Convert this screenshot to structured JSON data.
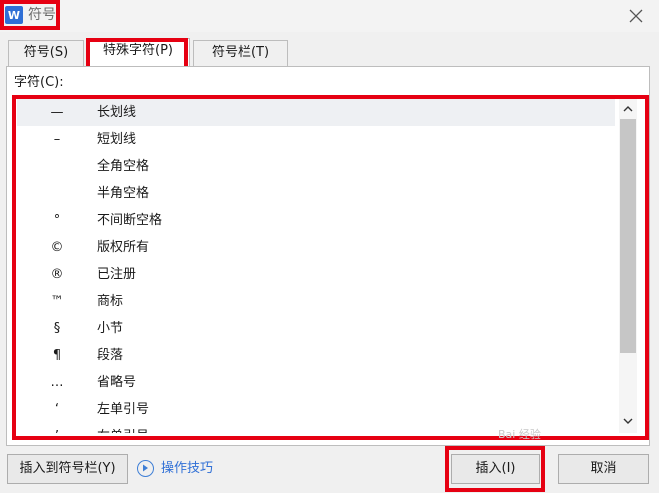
{
  "window": {
    "title": "符号",
    "app_icon_letter": "W"
  },
  "tabs": [
    {
      "label": "符号(S)"
    },
    {
      "label": "特殊字符(P)"
    },
    {
      "label": "符号栏(T)"
    }
  ],
  "field": {
    "label": "字符(C):"
  },
  "symbols": [
    {
      "symbol": "—",
      "name": "长划线"
    },
    {
      "symbol": "–",
      "name": "短划线"
    },
    {
      "symbol": "",
      "name": "全角空格"
    },
    {
      "symbol": "",
      "name": "半角空格"
    },
    {
      "symbol": "°",
      "name": "不间断空格"
    },
    {
      "symbol": "©",
      "name": "版权所有"
    },
    {
      "symbol": "®",
      "name": "已注册"
    },
    {
      "symbol": "™",
      "name": "商标"
    },
    {
      "symbol": "§",
      "name": "小节"
    },
    {
      "symbol": "¶",
      "name": "段落"
    },
    {
      "symbol": "…",
      "name": "省略号"
    },
    {
      "symbol": "‘",
      "name": "左单引号"
    },
    {
      "symbol": "’",
      "name": "右单引号"
    }
  ],
  "buttons": {
    "insert_to_bar": "插入到符号栏(Y)",
    "tips": "操作技巧",
    "insert": "插入(I)",
    "cancel": "取消"
  },
  "watermark": "Bai 经验",
  "colors": {
    "highlight": "#e60012",
    "accent": "#2f6fd6"
  }
}
